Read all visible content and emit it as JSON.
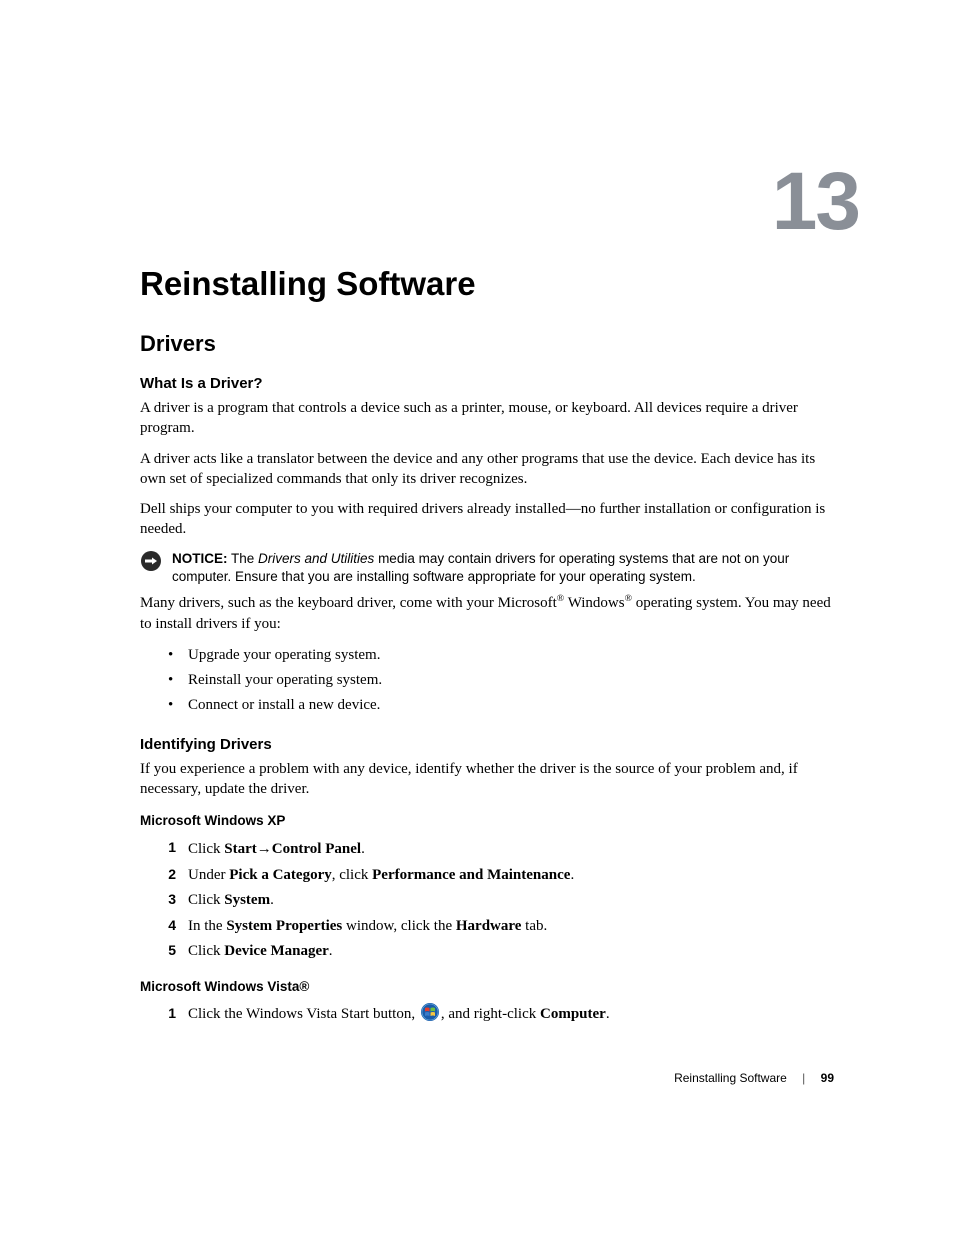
{
  "chapter": {
    "number": "13",
    "title": "Reinstalling Software"
  },
  "drivers": {
    "section_title": "Drivers",
    "what_is": {
      "heading": "What Is a Driver?",
      "p1": "A driver is a program that controls a device such as a printer, mouse, or keyboard. All devices require a driver program.",
      "p2": "A driver acts like a translator between the device and any other programs that use the device. Each device has its own set of specialized commands that only its driver recognizes.",
      "p3": "Dell ships your computer to you with required drivers already installed—no further installation or configuration is needed."
    },
    "notice": {
      "label": "NOTICE:",
      "italic": "Drivers and Utilities",
      "before": " The ",
      "after": " media may contain drivers for operating systems that are not on your computer. Ensure that you are installing software appropriate for your operating system."
    },
    "many": {
      "pre": "Many drivers, such as the keyboard driver, come with your Microsoft",
      "mid": " Windows",
      "post": " operating system. You may need to install drivers if you:"
    },
    "bullets": [
      "Upgrade your operating system.",
      "Reinstall your operating system.",
      "Connect or install a new device."
    ],
    "identifying": {
      "heading": "Identifying Drivers",
      "p1": "If you experience a problem with any device, identify whether the driver is the source of your problem and, if necessary, update the driver."
    },
    "xp": {
      "heading": "Microsoft Windows XP",
      "steps": {
        "s1": {
          "pre": "Click ",
          "b1": "Start",
          "arrow": "→",
          "b2": "Control Panel",
          "post": "."
        },
        "s2": {
          "pre": "Under ",
          "b1": "Pick a Category",
          "mid": ", click ",
          "b2": "Performance and Maintenance",
          "post": "."
        },
        "s3": {
          "pre": "Click ",
          "b1": "System",
          "post": "."
        },
        "s4": {
          "pre": "In the ",
          "b1": "System Properties",
          "mid": " window, click the ",
          "b2": "Hardware",
          "post": " tab."
        },
        "s5": {
          "pre": "Click ",
          "b1": "Device Manager",
          "post": "."
        }
      }
    },
    "vista": {
      "heading": "Microsoft Windows Vista®",
      "step1": {
        "pre": "Click the Windows Vista Start button, ",
        "mid": ", and right-click ",
        "b1": "Computer",
        "post": "."
      }
    }
  },
  "footer": {
    "text": "Reinstalling Software",
    "page": "99"
  }
}
